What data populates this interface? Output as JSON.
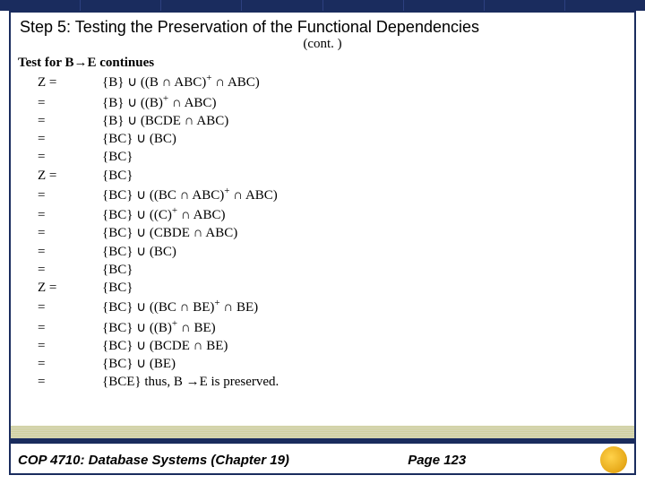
{
  "title": "Step 5: Testing the Preservation of the Functional Dependencies",
  "cont": "(cont. )",
  "testLine": "Test for B→E continues",
  "lines": [
    {
      "label": "Z =",
      "body": "{B} ∪ ((B ∩ ABC)<sup class='sup'>+</sup> ∩ ABC)"
    },
    {
      "label": "=",
      "body": "{B} ∪ ((B)<sup class='sup'>+</sup> ∩ ABC)"
    },
    {
      "label": "=",
      "body": "{B} ∪ (BCDE ∩ ABC)"
    },
    {
      "label": "=",
      "body": "{BC} ∪ (BC)"
    },
    {
      "label": "=",
      "body": "{BC}"
    },
    {
      "label": "Z =",
      "body": "{BC}"
    },
    {
      "label": "=",
      "body": "{BC} ∪ ((BC ∩ ABC)<sup class='sup'>+</sup> ∩ ABC)"
    },
    {
      "label": "=",
      "body": "{BC} ∪ ((C)<sup class='sup'>+</sup> ∩ ABC)"
    },
    {
      "label": "=",
      "body": "{BC} ∪ (CBDE ∩ ABC)"
    },
    {
      "label": "=",
      "body": "{BC} ∪ (BC)"
    },
    {
      "label": "=",
      "body": "{BC}"
    },
    {
      "label": "Z =",
      "body": "{BC}"
    },
    {
      "label": "=",
      "body": "{BC} ∪ ((BC ∩ BE)<sup class='sup'>+</sup> ∩ BE)"
    },
    {
      "label": "=",
      "body": "{BC} ∪ ((B)<sup class='sup'>+</sup> ∩ BE)"
    },
    {
      "label": "=",
      "body": "{BC} ∪ (BCDE ∩ BE)"
    },
    {
      "label": "=",
      "body": "{BC} ∪ (BE)"
    },
    {
      "label": "=",
      "body": "{BCE} thus, B →E is preserved."
    }
  ],
  "footer": {
    "left": "COP 4710: Database Systems  (Chapter 19)",
    "page": "Page 123"
  }
}
